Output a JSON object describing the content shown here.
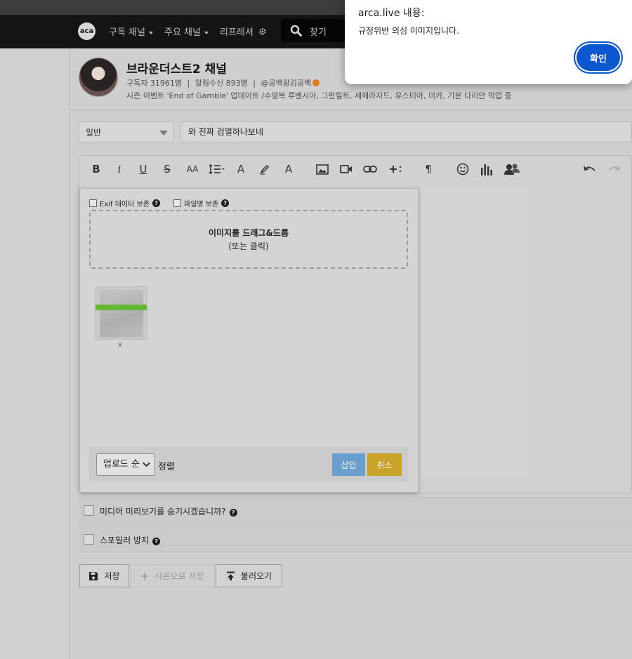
{
  "nav": {
    "logo_text": "aca",
    "items": [
      {
        "label": "구독 채널",
        "has_caret": true
      },
      {
        "label": "주요 채널",
        "has_caret": true
      },
      {
        "label": "리프레셔",
        "has_caret": false
      }
    ],
    "search_placeholder": "찾기"
  },
  "channel": {
    "title": "브라운더스트2 채널",
    "subscribers": "구독자 31961명",
    "notifications": "알림수신 893명",
    "owner": "@공백왕김공백",
    "description": "시즌 이벤트 'End of Gamble' 업데이트 /수영복 루벤시아, 그란힐트, 세헤라자드, 유스티아, 미카, 기본 다리안 픽업 중",
    "separator": "|"
  },
  "post": {
    "category": "일반",
    "title_value": "와 진짜 검열하나보네"
  },
  "upload": {
    "exif_label": "Exif 데이터 보존",
    "filename_label": "파일명 보존",
    "help_glyph": "?",
    "drop_line1": "이미지를 드래그&드롭",
    "drop_line2": "(또는 클릭)",
    "thumb_remove": "x",
    "sort_value": "업로드 순",
    "sort_label": "정렬",
    "insert_label": "삽입",
    "cancel_label": "취소"
  },
  "options": {
    "hide_preview": "미디어 미리보기를 숨기시겠습니까?",
    "spoiler": "스포일러 방지"
  },
  "actions": {
    "save": "저장",
    "save_draft": "사본으로 저장",
    "load": "불러오기"
  },
  "dialog": {
    "title": "arca.live 내용:",
    "message": "규정위반 의심 이미지입니다.",
    "ok": "확인",
    "ok_color": "#0b57d0"
  },
  "toolbar": {
    "icons": [
      "bold-icon",
      "italic-icon",
      "underline-icon",
      "strikethrough-icon",
      "font-size-icon",
      "line-height-icon",
      "font-color-icon",
      "highlight-icon",
      "clear-format-icon",
      "image-icon",
      "video-icon",
      "link-icon",
      "insert-more-icon",
      "paragraph-icon",
      "emoji-icon",
      "chart-icon",
      "people-icon",
      "undo-icon",
      "redo-icon"
    ],
    "bold": "B",
    "italic": "i",
    "underline": "U",
    "strike": "S",
    "fontsize": "AA",
    "fontcolor": "A",
    "clearformat": "A",
    "paragraph": "¶"
  }
}
